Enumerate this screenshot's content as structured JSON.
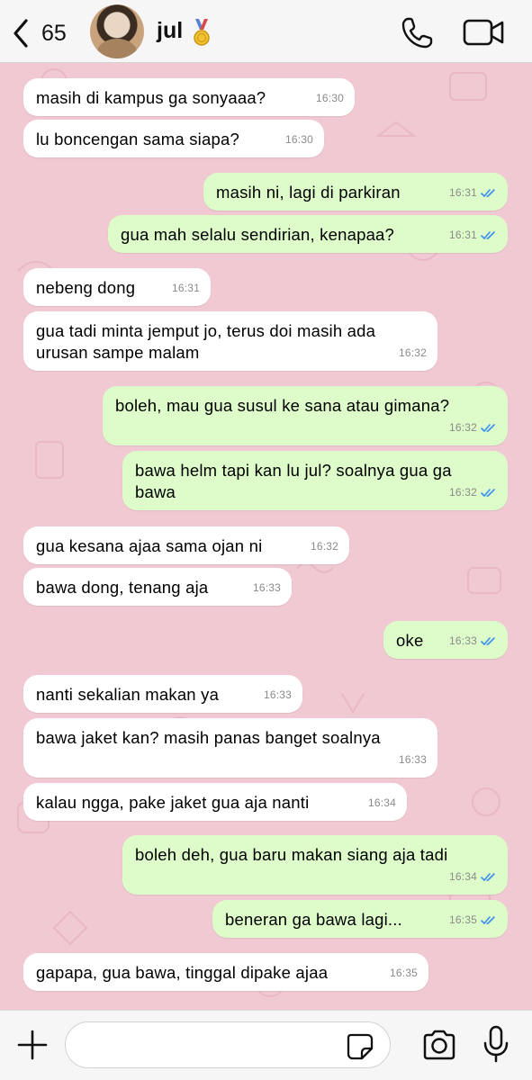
{
  "header": {
    "back_count": "65",
    "contact_name": "jul",
    "medal_emoji": "gold-medal"
  },
  "input": {
    "value": "",
    "placeholder": ""
  },
  "colors": {
    "chat_background": "#f1c9d2",
    "incoming_bubble": "#ffffff",
    "outgoing_bubble": "#ddfcc9",
    "read_ticks": "#3a8ff0"
  },
  "messages": [
    {
      "dir": "in",
      "text": "masih di kampus ga sonyaaa?",
      "time": "16:30"
    },
    {
      "dir": "in",
      "text": "lu boncengan sama siapa?",
      "time": "16:30"
    },
    {
      "dir": "out",
      "text": "masih ni, lagi di parkiran",
      "time": "16:31",
      "read": true
    },
    {
      "dir": "out",
      "text": "gua mah selalu sendirian, kenapaa?",
      "time": "16:31",
      "read": true
    },
    {
      "dir": "in",
      "text": "nebeng dong",
      "time": "16:31"
    },
    {
      "dir": "in",
      "text": "gua tadi minta jemput jo, terus doi masih ada urusan sampe malam",
      "time": "16:32"
    },
    {
      "dir": "out",
      "text": "boleh, mau gua susul ke sana atau gimana?",
      "time": "16:32",
      "read": true
    },
    {
      "dir": "out",
      "text": "bawa helm tapi kan lu jul? soalnya gua ga bawa",
      "time": "16:32",
      "read": true
    },
    {
      "dir": "in",
      "text": "gua kesana ajaa sama ojan ni",
      "time": "16:32"
    },
    {
      "dir": "in",
      "text": "bawa dong, tenang aja",
      "time": "16:33"
    },
    {
      "dir": "out",
      "text": "oke",
      "time": "16:33",
      "read": true
    },
    {
      "dir": "in",
      "text": "nanti sekalian makan ya",
      "time": "16:33"
    },
    {
      "dir": "in",
      "text": "bawa jaket kan? masih panas banget soalnya",
      "time": "16:33"
    },
    {
      "dir": "in",
      "text": "kalau ngga, pake jaket gua aja nanti",
      "time": "16:34"
    },
    {
      "dir": "out",
      "text": "boleh deh, gua baru makan siang aja tadi",
      "time": "16:34",
      "read": true
    },
    {
      "dir": "out",
      "text": "beneran ga bawa lagi...",
      "time": "16:35",
      "read": true
    },
    {
      "dir": "in",
      "text": "gapapa, gua bawa, tinggal dipake ajaa",
      "time": "16:35"
    }
  ]
}
